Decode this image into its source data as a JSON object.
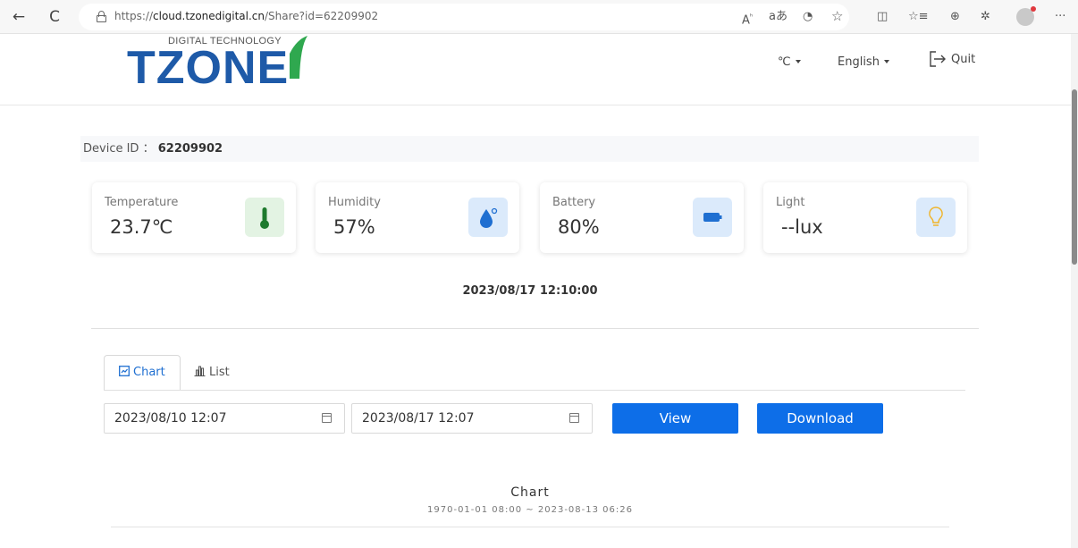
{
  "browser": {
    "url_prefix": "https://",
    "url_domain": "cloud.tzonedigital.cn",
    "url_path": "/Share?id=62209902",
    "back_glyph": "←",
    "reload_glyph": "C",
    "more_glyph": "···"
  },
  "header": {
    "logo_sub": "DIGITAL TECHNOLOGY",
    "logo_main": "TZONE",
    "unit_selector": "℃",
    "language_selector": "English",
    "quit_label": "Quit",
    "brand_colors": {
      "blue": "#1e5aa8",
      "green": "#2fa84f"
    }
  },
  "device": {
    "label": "Device ID",
    "separator": "：",
    "id": "62209902"
  },
  "cards": [
    {
      "label": "Temperature",
      "value": "23.7℃",
      "icon": "thermometer-icon",
      "icon_bg": "#e3f3e3",
      "icon_color": "#1e7a2e"
    },
    {
      "label": "Humidity",
      "value": "57%",
      "icon": "water-drop-icon",
      "icon_bg": "#dbeafb",
      "icon_color": "#1f6fd1"
    },
    {
      "label": "Battery",
      "value": "80%",
      "icon": "battery-icon",
      "icon_bg": "#dbeafb",
      "icon_color": "#1f6fd1"
    },
    {
      "label": "Light",
      "value": "--lux",
      "icon": "lightbulb-icon",
      "icon_bg": "#dbeafb",
      "icon_color": "#f0b429"
    }
  ],
  "timestamp": "2023/08/17 12:10:00",
  "tabs": [
    {
      "label": "Chart",
      "active": true
    },
    {
      "label": "List",
      "active": false
    }
  ],
  "query": {
    "start_date": "2023/08/10 12:07",
    "end_date": "2023/08/17 12:07",
    "view_label": "View",
    "download_label": "Download",
    "accent": "#0d6ee8"
  },
  "chart": {
    "title": "Chart",
    "range": "1970-01-01 08:00 ~ 2023-08-13 06:26"
  }
}
